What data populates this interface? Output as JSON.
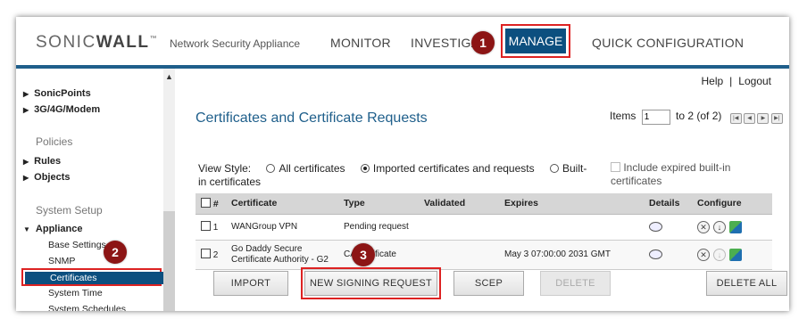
{
  "header": {
    "logo_prefix": "SONIC",
    "logo_suffix": "WALL",
    "logo_tm": "™",
    "product": "Network Security Appliance",
    "nav": {
      "monitor": "MONITOR",
      "investigate": "INVESTIGATE",
      "manage": "MANAGE",
      "quick": "QUICK CONFIGURATION"
    }
  },
  "callouts": {
    "one": "1",
    "two": "2",
    "three": "3"
  },
  "sidebar": {
    "items_top": [
      "SonicPoints",
      "3G/4G/Modem"
    ],
    "policies_label": "Policies",
    "policies_items": [
      "Rules",
      "Objects"
    ],
    "system_setup_label": "System Setup",
    "appliance_label": "Appliance",
    "appliance_items": [
      "Base Settings",
      "SNMP",
      "Certificates",
      "System Time",
      "System Schedules"
    ],
    "scroll_up": "▲"
  },
  "top_links": {
    "help": "Help",
    "separator": "|",
    "logout": "Logout"
  },
  "page_title": "Certificates and Certificate Requests",
  "pager": {
    "items_label": "Items",
    "start_value": "1",
    "range_text": "to 2 (of 2)",
    "first": "|◀",
    "prev": "◀",
    "next": "▶",
    "last": "▶|"
  },
  "view_style": {
    "label": "View Style:",
    "options": [
      "All certificates",
      "Imported certificates and requests",
      "Built-in certificates"
    ],
    "selected": "Imported certificates and requests",
    "include_expired": "Include expired built-in certificates"
  },
  "table": {
    "headers": [
      "#",
      "Certificate",
      "Type",
      "Validated",
      "Expires",
      "Details",
      "Configure"
    ],
    "rows": [
      {
        "num": "1",
        "certificate": "WANGroup VPN",
        "type": "Pending request",
        "validated": "",
        "expires": ""
      },
      {
        "num": "2",
        "certificate": "Go Daddy Secure Certificate Authority - G2",
        "type": "CA certificate",
        "validated": "",
        "expires": "May 3 07:00:00 2031 GMT"
      }
    ]
  },
  "buttons": {
    "import": "IMPORT",
    "new_signing_request": "NEW SIGNING REQUEST",
    "scep": "SCEP",
    "delete": "DELETE",
    "delete_all": "DELETE ALL"
  },
  "colors": {
    "brand_blue": "#0c4f7f",
    "title_blue": "#1f5f8b",
    "highlight_red": "#dd2222",
    "callout": "#8c1515"
  },
  "icons": {
    "details": "comment-bubble-icon",
    "delete": "delete-circle-icon",
    "download": "download-icon",
    "configure": "configure-cubes-icon"
  }
}
